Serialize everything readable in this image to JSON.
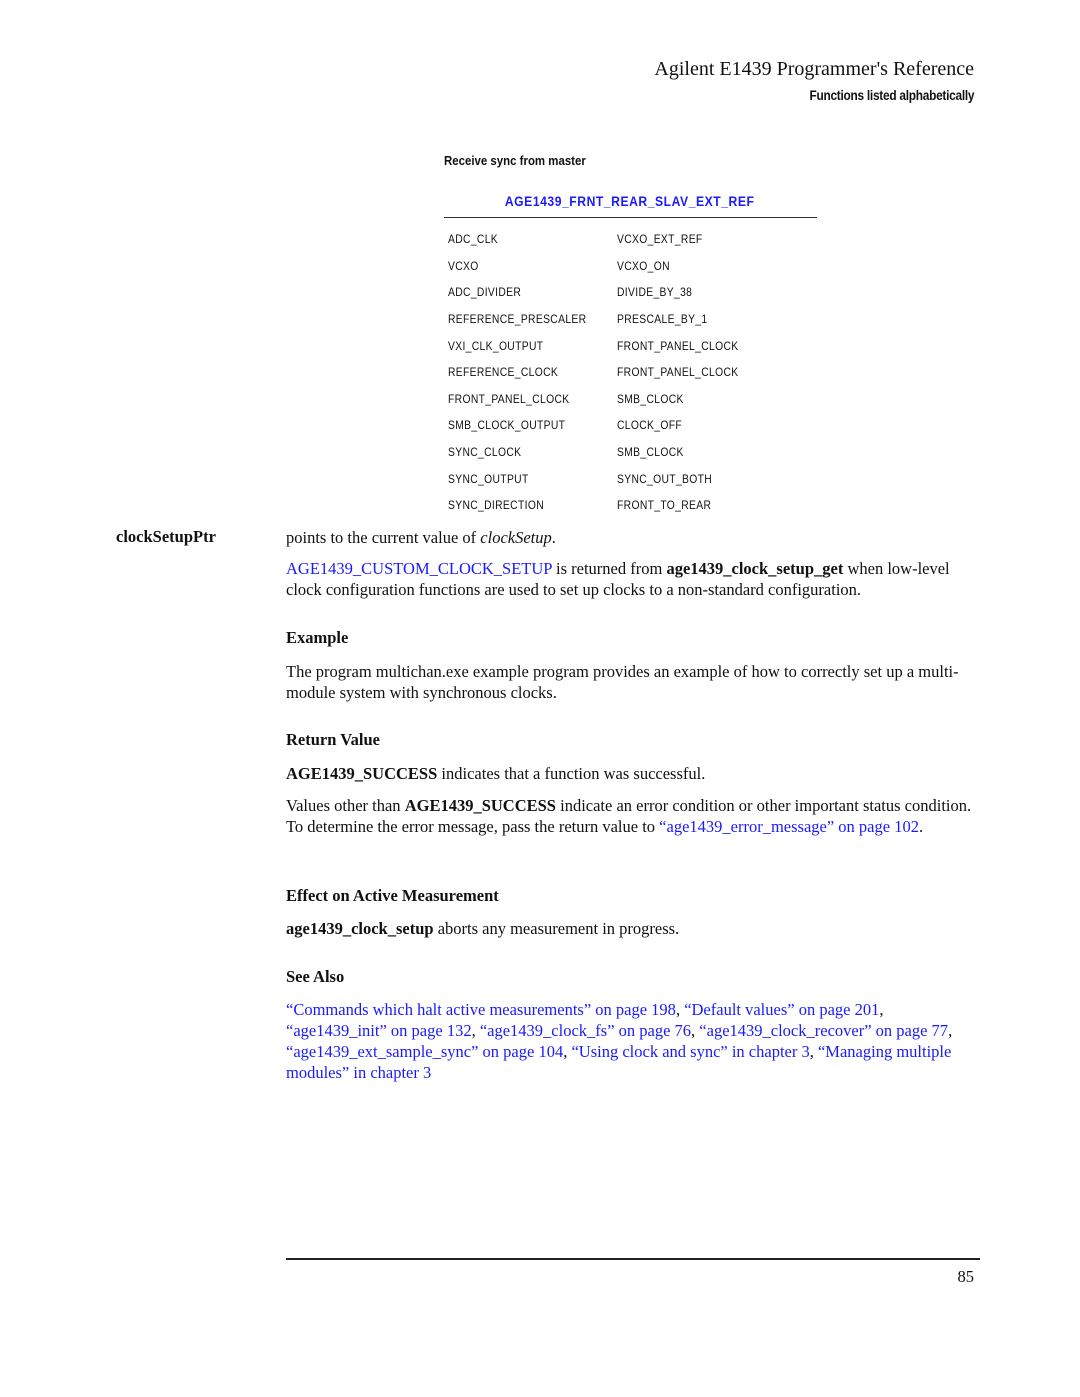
{
  "header": {
    "title": "Agilent E1439 Programmer's Reference",
    "subtitle": "Functions listed alphabetically"
  },
  "table": {
    "caption": "Receive sync from master",
    "title": "AGE1439_FRNT_REAR_SLAV_EXT_REF",
    "rows": [
      [
        "ADC_CLK",
        "VCXO_EXT_REF"
      ],
      [
        "VCXO",
        "VCXO_ON"
      ],
      [
        "ADC_DIVIDER",
        "DIVIDE_BY_38"
      ],
      [
        "REFERENCE_PRESCALER",
        "PRESCALE_BY_1"
      ],
      [
        "VXI_CLK_OUTPUT",
        "FRONT_PANEL_CLOCK"
      ],
      [
        "REFERENCE_CLOCK",
        "FRONT_PANEL_CLOCK"
      ],
      [
        "FRONT_PANEL_CLOCK",
        "SMB_CLOCK"
      ],
      [
        "SMB_CLOCK_OUTPUT",
        "CLOCK_OFF"
      ],
      [
        "SYNC_CLOCK",
        "SMB_CLOCK"
      ],
      [
        "SYNC_OUTPUT",
        "SYNC_OUT_BOTH"
      ],
      [
        "SYNC_DIRECTION",
        "FRONT_TO_REAR"
      ]
    ]
  },
  "param": {
    "name": "clockSetupPtr",
    "desc_prefix": "points to the current value of ",
    "desc_italic": "clockSetup",
    "desc_suffix": ".",
    "note_link": "AGE1439_CUSTOM_CLOCK_SETUP",
    "note_mid": " is returned from ",
    "note_bold": "age1439_clock_setup_get",
    "note_suffix": " when low-level clock configuration functions are used to set up clocks to a non-standard configuration."
  },
  "example": {
    "heading": "Example",
    "text": "The program multichan.exe example program provides an example of how to correctly set up a multi-module system with synchronous clocks."
  },
  "return_value": {
    "heading": "Return Value",
    "p1_bold": "AGE1439_SUCCESS",
    "p1_text": " indicates that a function was successful.",
    "p2_prefix": "Values other than ",
    "p2_bold": "AGE1439_SUCCESS",
    "p2_text": " indicate an error condition or other important status condition. To determine the error message, pass the return value to ",
    "p2_link": "“age1439_error_message” on page 102",
    "p2_suffix": "."
  },
  "effect": {
    "heading": "Effect on Active Measurement",
    "bold": "age1439_clock_setup",
    "text": " aborts any measurement in progress."
  },
  "see_also": {
    "heading": "See Also",
    "links": [
      "“Commands which halt active measurements” on page 198",
      "“Default values” on page 201",
      "“age1439_init” on page 132",
      "“age1439_clock_fs” on page 76",
      "“age1439_clock_recover” on page 77",
      "“age1439_ext_sample_sync” on page 104",
      "“Using clock and sync” in chapter 3",
      "“Managing multiple modules” in chapter 3"
    ],
    "separator": ", "
  },
  "footer": {
    "page_number": "85"
  },
  "colors": {
    "link": "#1a1aff",
    "text": "#111111"
  }
}
